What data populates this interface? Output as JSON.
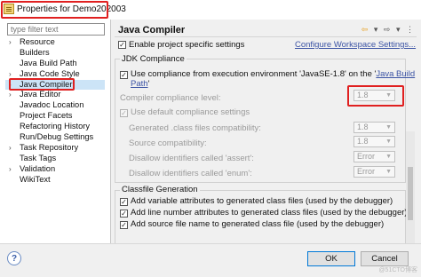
{
  "window": {
    "title": "Properties for Demo202003"
  },
  "sidebar": {
    "filter_placeholder": "type filter text",
    "items": [
      {
        "label": "Resource",
        "arrow": "›"
      },
      {
        "label": "Builders",
        "arrow": ""
      },
      {
        "label": "Java Build Path",
        "arrow": ""
      },
      {
        "label": "Java Code Style",
        "arrow": "›"
      },
      {
        "label": "Java Compiler",
        "arrow": "›"
      },
      {
        "label": "Java Editor",
        "arrow": "›"
      },
      {
        "label": "Javadoc Location",
        "arrow": ""
      },
      {
        "label": "Project Facets",
        "arrow": ""
      },
      {
        "label": "Refactoring History",
        "arrow": ""
      },
      {
        "label": "Run/Debug Settings",
        "arrow": ""
      },
      {
        "label": "Task Repository",
        "arrow": "›"
      },
      {
        "label": "Task Tags",
        "arrow": ""
      },
      {
        "label": "Validation",
        "arrow": "›"
      },
      {
        "label": "WikiText",
        "arrow": ""
      }
    ],
    "selected_index": 4
  },
  "main": {
    "title": "Java Compiler",
    "enable_specific": "Enable project specific settings",
    "configure_link": "Configure Workspace Settings...",
    "jdk_group": "JDK Compliance",
    "use_compliance_prefix": "Use compliance from execution environment 'JavaSE-1.8' on the '",
    "use_compliance_link1": "Java Build",
    "use_compliance_link2": "Path",
    "use_compliance_suffix": "'",
    "compliance_level_label": "Compiler compliance level:",
    "compliance_level_value": "1.8",
    "use_default": "Use default compliance settings",
    "generated_label": "Generated .class files compatibility:",
    "generated_value": "1.8",
    "source_label": "Source compatibility:",
    "source_value": "1.8",
    "assert_label": "Disallow identifiers called 'assert':",
    "assert_value": "Error",
    "enum_label": "Disallow identifiers called 'enum':",
    "enum_value": "Error",
    "classfile_group": "Classfile Generation",
    "cf1": "Add variable attributes to generated class files (used by the debugger)",
    "cf2": "Add line number attributes to generated class files (used by the debugger)",
    "cf3": "Add source file name to generated class file (used by the debugger)"
  },
  "footer": {
    "help": "?",
    "ok": "OK",
    "cancel": "Cancel"
  },
  "watermark": "@51CTO博客"
}
